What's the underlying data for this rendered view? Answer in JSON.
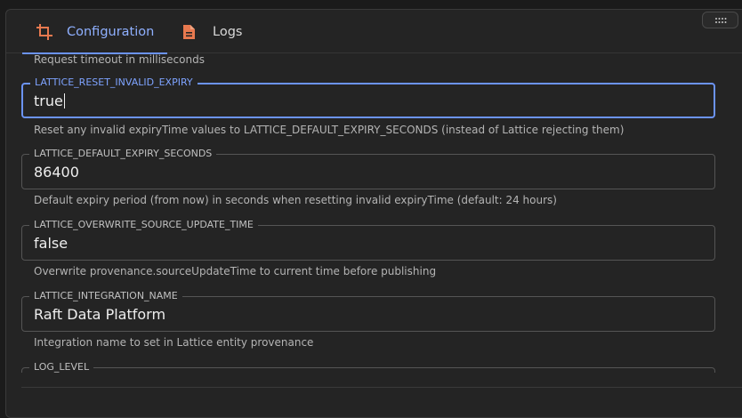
{
  "tabs": [
    {
      "label": "Configuration",
      "icon": "crop-icon",
      "active": true
    },
    {
      "label": "Logs",
      "icon": "document-icon",
      "active": false
    }
  ],
  "top_helper": "Request timeout in milliseconds",
  "fields": [
    {
      "label": "LATTICE_RESET_INVALID_EXPIRY",
      "value": "true",
      "helper": "Reset any invalid expiryTime values to LATTICE_DEFAULT_EXPIRY_SECONDS (instead of Lattice rejecting them)",
      "focused": true
    },
    {
      "label": "LATTICE_DEFAULT_EXPIRY_SECONDS",
      "value": "86400",
      "helper": "Default expiry period (from now) in seconds when resetting invalid expiryTime (default: 24 hours)"
    },
    {
      "label": "LATTICE_OVERWRITE_SOURCE_UPDATE_TIME",
      "value": "false",
      "helper": "Overwrite provenance.sourceUpdateTime to current time before publishing"
    },
    {
      "label": "LATTICE_INTEGRATION_NAME",
      "value": "Raft Data Platform",
      "helper": "Integration name to set in Lattice entity provenance"
    },
    {
      "label": "LOG_LEVEL",
      "value": ""
    }
  ],
  "colors": {
    "accent": "#6b93f5",
    "tab_icon": "#e8794f"
  }
}
